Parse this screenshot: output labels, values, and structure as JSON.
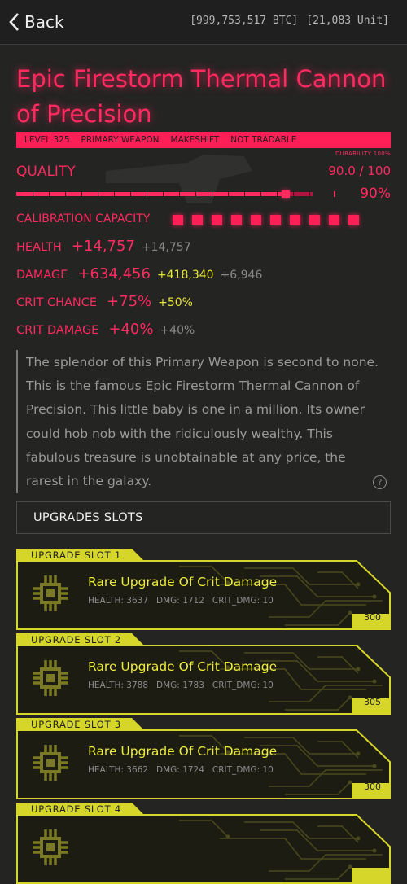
{
  "header": {
    "back_label": "Back",
    "btc_balance": "[999,753,517 BTC]",
    "unit_balance": "[21,083 Unit]"
  },
  "item": {
    "title": "Epic Firestorm Thermal Cannon of Precision",
    "tags": [
      "LEVEL 325",
      "PRIMARY WEAPON",
      "MAKESHIFT",
      "NOT TRADABLE"
    ],
    "durability_label": "DURABILITY 100%",
    "quality_label": "QUALITY",
    "quality_value": "90.0 / 100",
    "quality_percent": "90%",
    "quality_fraction": 0.9,
    "calibration_label": "CALIBRATION CAPACITY",
    "calibration_count": 10,
    "stats": [
      {
        "label": "HEALTH",
        "main": "+14,757",
        "bonus": "",
        "base": "+14,757"
      },
      {
        "label": "DAMAGE",
        "main": "+634,456",
        "bonus": "+418,340",
        "base": "+6,946"
      },
      {
        "label": "CRIT CHANCE",
        "main": "+75%",
        "bonus": "+50%",
        "base": ""
      },
      {
        "label": "CRIT DAMAGE",
        "main": "+40%",
        "bonus": "",
        "base": "+40%"
      }
    ],
    "description": "The splendor of this Primary Weapon is second to none. This is the famous Epic Firestorm Thermal Cannon of Precision. This little baby is one in a million. Its owner could hob nob with the ridiculously wealthy. This fabulous treasure is unobtainable at any price, the rarest in the galaxy.",
    "help_glyph": "?"
  },
  "upgrades": {
    "header": "UPGRADES SLOTS",
    "slots": [
      {
        "tag": "UPGRADE SLOT 1",
        "name": "Rare Upgrade Of Crit Damage",
        "health": "HEALTH: 3637",
        "dmg": "DMG: 1712",
        "crit": "CRIT_DMG: 10",
        "price": "300"
      },
      {
        "tag": "UPGRADE SLOT 2",
        "name": "Rare Upgrade Of Crit Damage",
        "health": "HEALTH: 3788",
        "dmg": "DMG: 1783",
        "crit": "CRIT_DMG: 10",
        "price": "305"
      },
      {
        "tag": "UPGRADE SLOT 3",
        "name": "Rare Upgrade Of Crit Damage",
        "health": "HEALTH: 3662",
        "dmg": "DMG: 1724",
        "crit": "CRIT_DMG: 10",
        "price": "300"
      },
      {
        "tag": "UPGRADE SLOT 4",
        "name": "",
        "health": "",
        "dmg": "",
        "crit": "",
        "price": ""
      }
    ]
  },
  "colors": {
    "accent_pink": "#ff2a5f",
    "accent_yellow": "#d6d62a",
    "background": "#242423"
  },
  "icons": {
    "back": "chevron-left-icon",
    "help": "question-circle-icon",
    "chip": "microchip-icon"
  }
}
